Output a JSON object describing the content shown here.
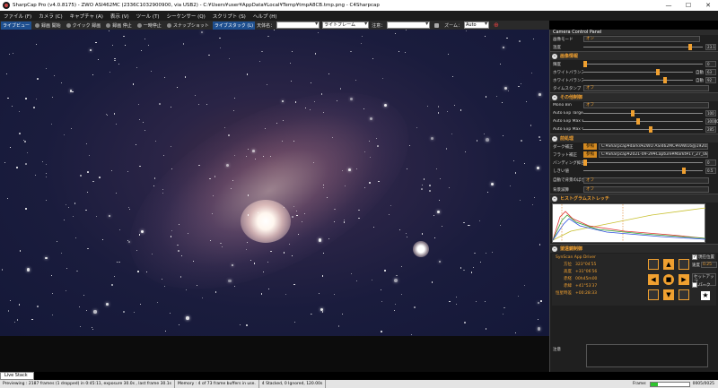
{
  "window": {
    "title": "SharpCap Pro (v4.0.8175) - ZWO ASI462MC (2336C1032900900, via USB2) - C:¥Users¥user¥AppData¥Local¥Temp¥tmpA8CB.tmp.png - C4Sharpcap",
    "minimize": "—",
    "maximize": "☐",
    "close": "✕"
  },
  "menu": [
    "ファイル (F)",
    "カメラ (C)",
    "キャプチャ (A)",
    "表示 (V)",
    "ツール (T)",
    "シーケンサー (Q)",
    "スクリプト (S)",
    "ヘルプ (H)"
  ],
  "toolbar": {
    "live_view": "ライブビュー",
    "capture": "録画 開始",
    "quick_capture": "クイック 録画",
    "stop": "録画 停止",
    "pause": "一時停止",
    "snapshot": "スナップショット",
    "live_stack": "ライブスタック (L)",
    "target_label": "天体名：",
    "frame_type": "ライトフレーム",
    "notes_label": "注意：",
    "zoom_label": "ズーム：",
    "zoom_value": "Auto"
  },
  "panel": {
    "header": "Camera Control Panel",
    "top_rows": [
      {
        "label": "画像モード",
        "value": "オン"
      },
      {
        "label": "温度",
        "value": "23.1"
      }
    ],
    "sections": {
      "image": "画像情報",
      "thermal": "その他制御",
      "pre": "前処理",
      "histogram": "ヒストグラムストレッチ",
      "scope": "望遠鏡制御"
    },
    "image_rows": [
      {
        "label": "輝度",
        "num": "0"
      },
      {
        "label": "ホワイトバランス(R)",
        "auto": "自動",
        "num": "63"
      },
      {
        "label": "ホワイトバランス(B)",
        "auto": "自動",
        "num": "92"
      },
      {
        "label": "タイムスタンプ",
        "value": "オフ"
      }
    ],
    "thermal_rows": [
      {
        "label": "Mono Bin",
        "value": "オフ"
      },
      {
        "label": "Auto Exp Target Brightness",
        "num": "100"
      },
      {
        "label": "Auto Exp Max Exp M S",
        "num": "30000"
      },
      {
        "label": "Auto Exp Max Gain",
        "num": "285"
      }
    ],
    "pre_rows": [
      {
        "label": "ダーク補正",
        "btn": "参照",
        "value": "C:¥Sharpcap¥darks¥ZWO ASI462MC¥RAW16@1920x..."
      },
      {
        "label": "フラット補正",
        "btn": "参照",
        "value": "C:¥Sharpcap¥2021-09-29¥Capture¥Markt¥17_27_08.fits"
      },
      {
        "label": "バンディング抑圧",
        "num": "0"
      },
      {
        "label": "しきい値",
        "num": "0.5"
      },
      {
        "label": "自動で背景のぼかし処理",
        "value": "オフ"
      },
      {
        "label": "背景減算",
        "value": "オフ"
      }
    ],
    "scope": {
      "driver": "SynScan App Driver",
      "track_label": "現在位置",
      "rate_label": "速度",
      "rate_value": "0.25",
      "rows": [
        {
          "k": "方位",
          "v": "323°04′55"
        },
        {
          "k": "高度",
          "v": "+31°06′56"
        },
        {
          "k": "赤経",
          "v": "00h45m00"
        },
        {
          "k": "赤緯",
          "v": "+41°53′37"
        },
        {
          "k": "恒星時差",
          "v": "+00:28:33"
        }
      ],
      "park": "パーク",
      "setup": "セットアップ",
      "notes_label": "注意"
    }
  },
  "status": {
    "live_stack_tab": "Live Stack",
    "previewing": "Previewing : 2187 frames (1 dropped) in 0:45:11, exposure 30.0s , last frame 30.1s",
    "memory": "Memory : 4 of 73 frame buffers in use.",
    "stacked": "4 Stacked, 0 Ignored, 120.00s",
    "frames_label": "Frame:",
    "frames_value": "0005/0025",
    "progress": 0.2
  },
  "colors": {
    "accent": "#f0a030",
    "highlight": "#1e4f8f"
  }
}
